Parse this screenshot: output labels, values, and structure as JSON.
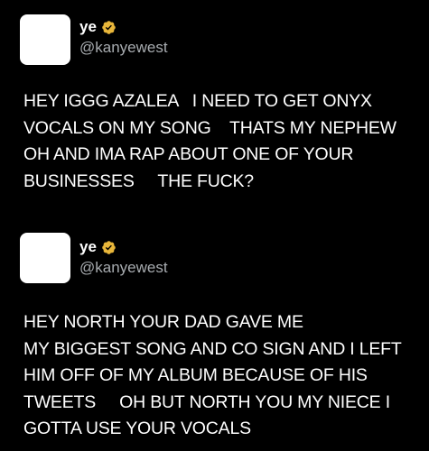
{
  "colors": {
    "background": "#000000",
    "text": "#ffffff",
    "handle": "#a8acb0",
    "avatar": "#ffffff",
    "verified_badge": "#e8b63a"
  },
  "tweets": [
    {
      "author": {
        "name": "ye",
        "handle": "@kanyewest",
        "verified_icon": "verified-badge-icon"
      },
      "lines": [
        "HEY IGGG AZALEA   I NEED TO GET ONYX",
        "VOCALS ON MY SONG    THATS MY NEPHEW",
        "OH AND IMA RAP ABOUT ONE OF YOUR",
        "BUSINESSES     THE FUCK?"
      ]
    },
    {
      "author": {
        "name": "ye",
        "handle": "@kanyewest",
        "verified_icon": "verified-badge-icon"
      },
      "lines": [
        "HEY NORTH YOUR DAD GAVE ME",
        "MY BIGGEST SONG AND CO SIGN AND I LEFT",
        "HIM OFF OF MY ALBUM BECAUSE OF HIS",
        "TWEETS     OH BUT NORTH YOU MY NIECE I",
        "GOTTA USE YOUR VOCALS"
      ]
    }
  ]
}
